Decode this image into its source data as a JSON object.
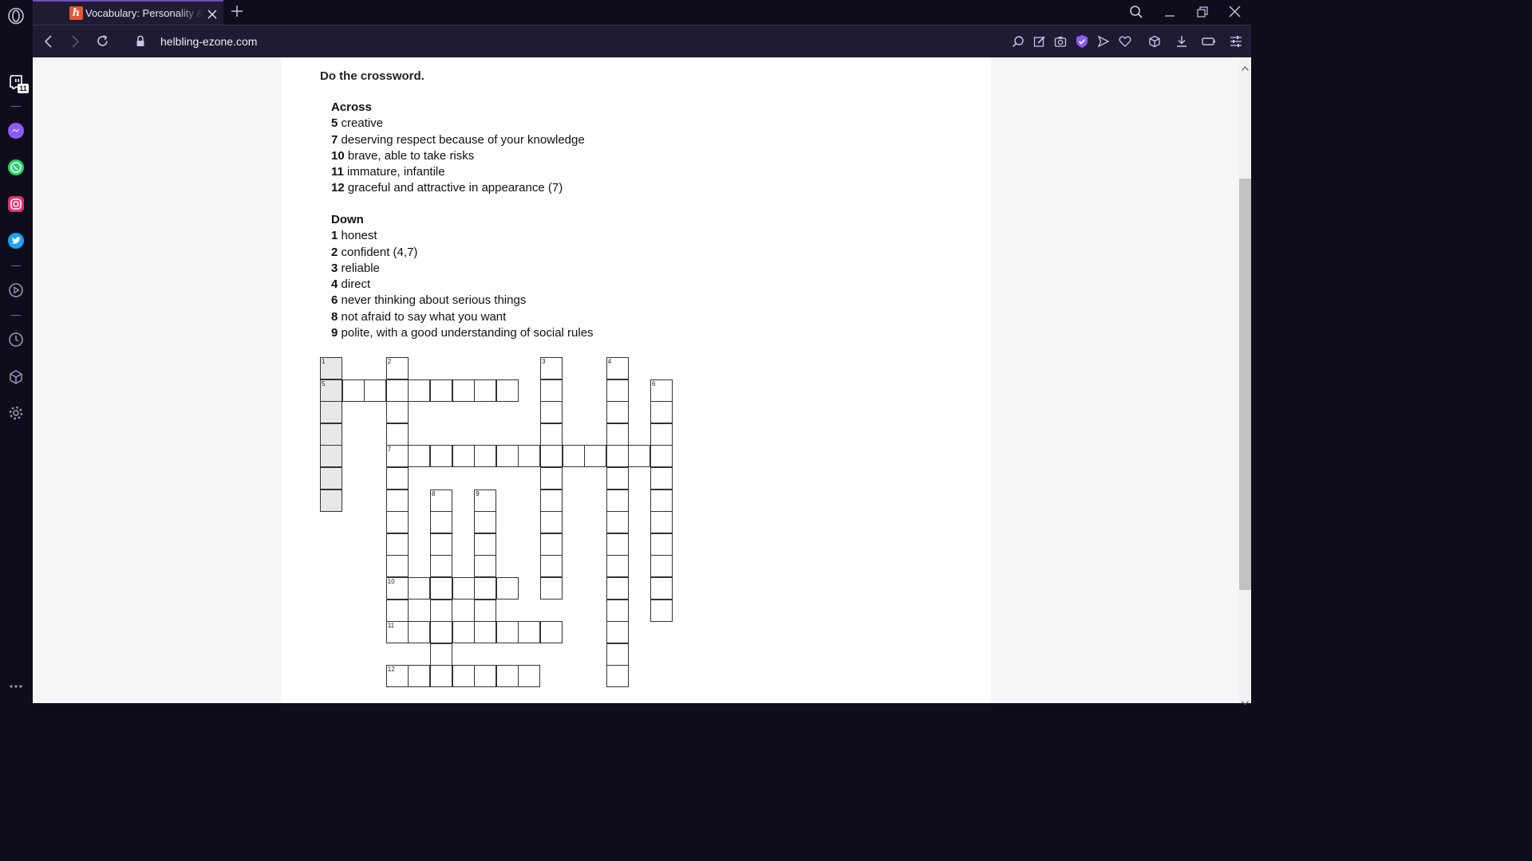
{
  "browser": {
    "tab_title": "Vocabulary: Personality & s",
    "tab_favicon_letter": "h",
    "url": "helbling-ezone.com",
    "sidebar_badge": "11",
    "accent_color": "#6b4fbf"
  },
  "exercise": {
    "instruction": "Do the crossword.",
    "across_heading": "Across",
    "across": [
      {
        "num": "5",
        "clue": "creative"
      },
      {
        "num": "7",
        "clue": "deserving respect because of your knowledge"
      },
      {
        "num": "10",
        "clue": "brave, able to take risks"
      },
      {
        "num": "11",
        "clue": "immature, infantile"
      },
      {
        "num": "12",
        "clue": "graceful and attractive in appearance (7)"
      }
    ],
    "down_heading": "Down",
    "down": [
      {
        "num": "1",
        "clue": "honest"
      },
      {
        "num": "2",
        "clue": "confident (4,7)"
      },
      {
        "num": "3",
        "clue": "reliable"
      },
      {
        "num": "4",
        "clue": "direct"
      },
      {
        "num": "6",
        "clue": "never thinking about serious things"
      },
      {
        "num": "8",
        "clue": "not afraid to say what you want"
      },
      {
        "num": "9",
        "clue": "polite, with a good understanding of social rules"
      }
    ]
  },
  "crossword": {
    "entries": [
      {
        "num": "1",
        "dir": "down",
        "length": 7,
        "row": 0,
        "col": 0
      },
      {
        "num": "2",
        "dir": "down",
        "length": 12,
        "row": 0,
        "col": 3
      },
      {
        "num": "3",
        "dir": "down",
        "length": 11,
        "row": 0,
        "col": 10
      },
      {
        "num": "4",
        "dir": "down",
        "length": 15,
        "row": 0,
        "col": 13
      },
      {
        "num": "5",
        "dir": "across",
        "length": 9,
        "row": 1,
        "col": 0
      },
      {
        "num": "6",
        "dir": "down",
        "length": 11,
        "row": 1,
        "col": 15
      },
      {
        "num": "7",
        "dir": "across",
        "length": 13,
        "row": 4,
        "col": 3
      },
      {
        "num": "8",
        "dir": "down",
        "length": 8,
        "row": 6,
        "col": 5
      },
      {
        "num": "9",
        "dir": "down",
        "length": 6,
        "row": 6,
        "col": 7
      },
      {
        "num": "10",
        "dir": "across",
        "length": 6,
        "row": 10,
        "col": 3
      },
      {
        "num": "11",
        "dir": "across",
        "length": 8,
        "row": 12,
        "col": 3
      },
      {
        "num": "12",
        "dir": "across",
        "length": 7,
        "row": 14,
        "col": 3
      }
    ],
    "shaded_entry": "1"
  }
}
